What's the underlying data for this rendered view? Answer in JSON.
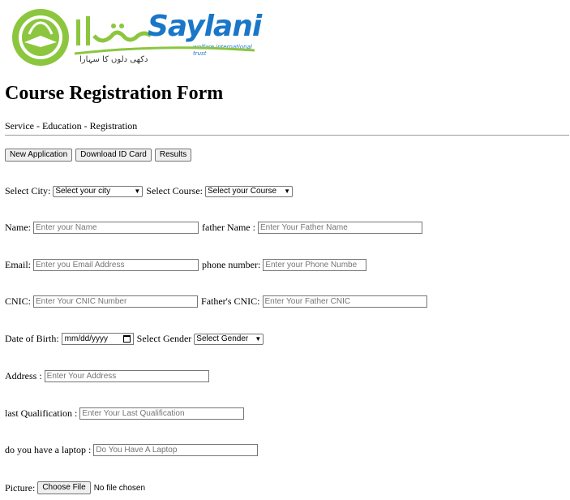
{
  "brand": {
    "name_latin": "Saylani",
    "name_urdu": "سیلانی",
    "tagline_en": "welfare international trust",
    "tagline_urdu": "دکھی دلوں کا سہارا",
    "colors": {
      "green": "#8cc63f",
      "blue": "#1976c8"
    }
  },
  "page": {
    "title": "Course Registration Form",
    "subtitle": "Service - Education - Registration"
  },
  "actions": [
    {
      "label": "New Application"
    },
    {
      "label": "Download ID Card"
    },
    {
      "label": "Results"
    }
  ],
  "form": {
    "city": {
      "label": "Select City:",
      "selected": "Select your city"
    },
    "course": {
      "label": "Select Course:",
      "selected": "Select your Course"
    },
    "name": {
      "label": "Name:",
      "placeholder": "Enter your Name"
    },
    "father_name": {
      "label": "father Name :",
      "placeholder": "Enter Your Father Name"
    },
    "email": {
      "label": "Email:",
      "placeholder": "Enter you Email Address"
    },
    "phone": {
      "label": "phone number:",
      "placeholder": "Enter your Phone Numbe"
    },
    "cnic": {
      "label": "CNIC:",
      "placeholder": "Enter Your CNIC Number"
    },
    "father_cnic": {
      "label": "Father's CNIC:",
      "placeholder": "Enter Your Father CNIC"
    },
    "dob": {
      "label": "Date of Birth:",
      "placeholder": "mm/dd/yyyy"
    },
    "gender": {
      "label": "Select Gender",
      "selected": "Select Gender"
    },
    "address": {
      "label": "Address :",
      "placeholder": "Enter Your Address"
    },
    "qualification": {
      "label": "last Qualification :",
      "placeholder": "Enter Your Last Qualification"
    },
    "laptop": {
      "label": "do you have a laptop :",
      "placeholder": "Do You Have A Laptop"
    },
    "picture": {
      "label": "Picture:",
      "button": "Choose File",
      "status": "No file chosen"
    }
  }
}
